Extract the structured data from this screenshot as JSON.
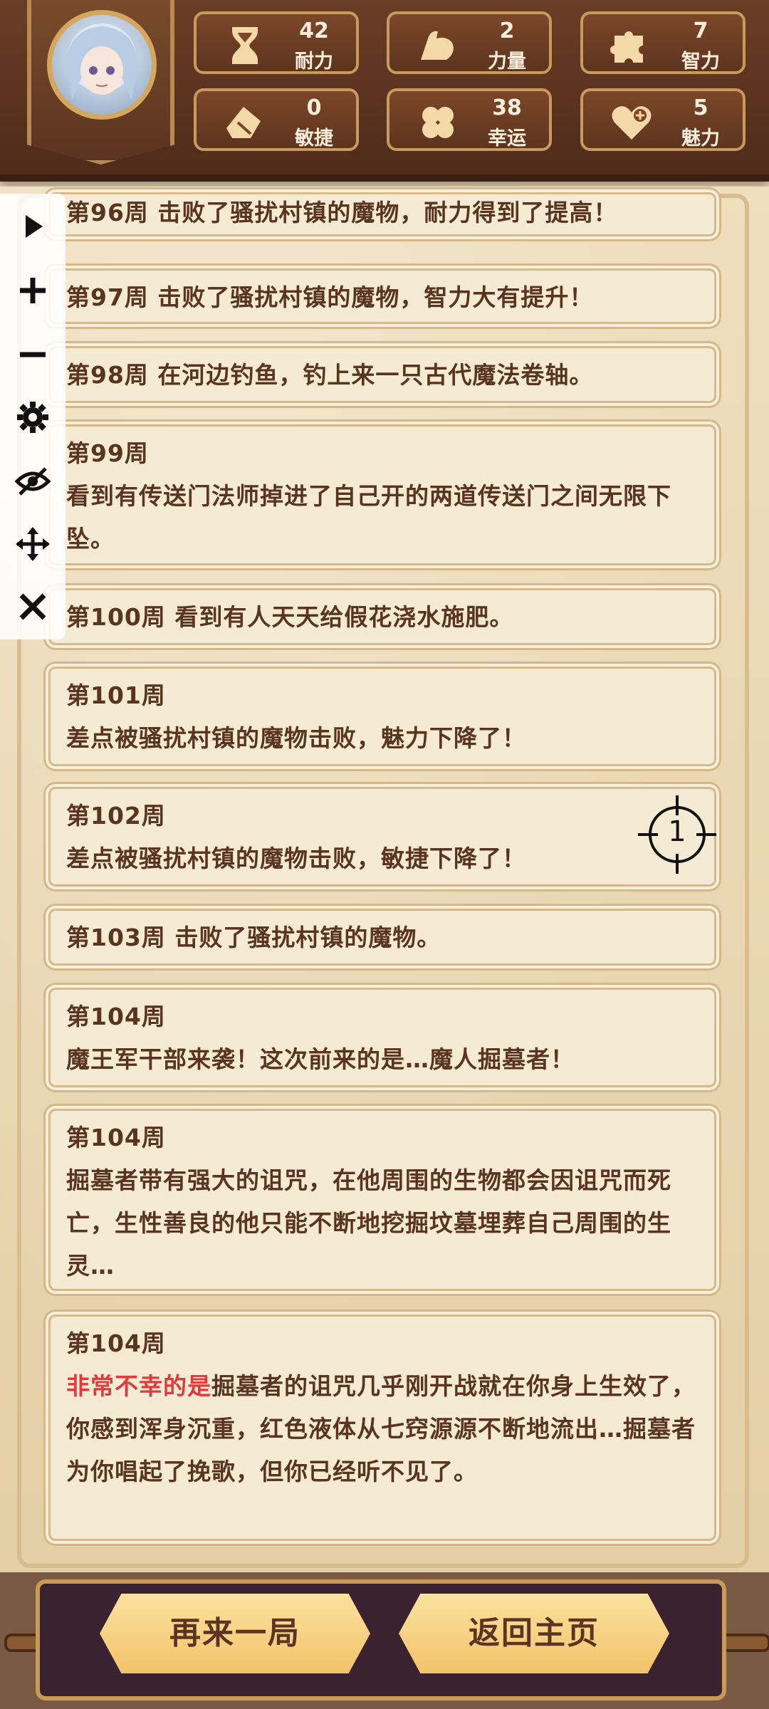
{
  "stats": [
    {
      "icon": "hourglass-icon",
      "value": "42",
      "label": "耐力"
    },
    {
      "icon": "muscle-arm-icon",
      "value": "2",
      "label": "力量"
    },
    {
      "icon": "puzzle-piece-icon",
      "value": "7",
      "label": "智力"
    },
    {
      "icon": "eraser-icon",
      "value": "0",
      "label": "敏捷"
    },
    {
      "icon": "clover-icon",
      "value": "38",
      "label": "幸运"
    },
    {
      "icon": "heart-plus-icon",
      "value": "5",
      "label": "魅力"
    }
  ],
  "log": [
    {
      "text": "第96周 击败了骚扰村镇的魔物，耐力得到了提高！"
    },
    {
      "text": "第97周 击败了骚扰村镇的魔物，智力大有提升！"
    },
    {
      "text": "第98周 在河边钓鱼，钓上来一只古代魔法卷轴。"
    },
    {
      "week": "第99周",
      "text": "看到有传送门法师掉进了自己开的两道传送门之间无限下坠。"
    },
    {
      "text": "第100周 看到有人天天给假花浇水施肥。"
    },
    {
      "week": "第101周",
      "text": "差点被骚扰村镇的魔物击败，魅力下降了！"
    },
    {
      "week": "第102周",
      "text": "差点被骚扰村镇的魔物击败，敏捷下降了！"
    },
    {
      "text": "第103周 击败了骚扰村镇的魔物。"
    },
    {
      "week": "第104周",
      "text": "魔王军干部来袭！这次前来的是…魔人掘墓者！"
    },
    {
      "week": "第104周",
      "text": "掘墓者带有强大的诅咒，在他周围的生物都会因诅咒而死亡，生性善良的他只能不断地挖掘坟墓埋葬自己周围的生灵…"
    },
    {
      "week": "第104周",
      "highlight": "非常不幸的是",
      "text": "掘墓者的诅咒几乎刚开战就在你身上生效了，你感到浑身沉重，红色液体从七窍源源不断地流出…掘墓者为你唱起了挽歌，但你已经听不见了。"
    }
  ],
  "target_label": "1",
  "buttons": {
    "retry": "再来一局",
    "home": "返回主页"
  },
  "toolbar": [
    "play-icon",
    "plus-icon",
    "minus-icon",
    "gear-icon",
    "eye-off-icon",
    "move-icon",
    "close-icon"
  ],
  "colors": {
    "highlight": "#e2393b",
    "text": "#5a3423"
  }
}
